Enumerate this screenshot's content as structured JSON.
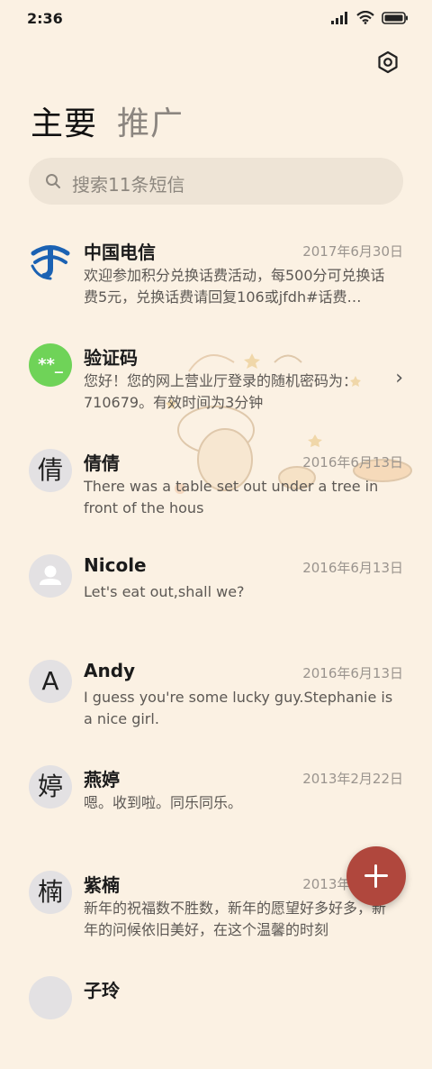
{
  "status": {
    "time": "2:36"
  },
  "tabs": [
    {
      "label": "主要",
      "active": true
    },
    {
      "label": "推广",
      "active": false
    }
  ],
  "search": {
    "placeholder": "搜索11条短信"
  },
  "messages": [
    {
      "name": "中国电信",
      "date": "2017年6月30日",
      "preview": "欢迎参加积分兑换话费活动，每500分可兑换话费5元，兑换话费请回复106或jfdh#话费…",
      "avatar": "",
      "avatar_icon": "china-telecom-logo"
    },
    {
      "name": "验证码",
      "date": "",
      "preview": "您好！您的网上营业厅登录的随机密码为：710679。有效时间为3分钟",
      "avatar": "**_",
      "avatar_color": "#6fd358"
    },
    {
      "name": "倩倩",
      "date": "2016年6月13日",
      "preview": "There was a table set out under a tree in front of the hous",
      "avatar": "倩"
    },
    {
      "name": "Nicole",
      "date": "2016年6月13日",
      "preview": "Let's eat out,shall we?",
      "avatar": "",
      "avatar_icon": "person-icon"
    },
    {
      "name": "Andy",
      "date": "2016年6月13日",
      "preview": "I guess you're some lucky guy.Stephanie is a nice girl.",
      "avatar": "A"
    },
    {
      "name": "燕婷",
      "date": "2013年2月22日",
      "preview": "嗯。收到啦。同乐同乐。",
      "avatar": "婷"
    },
    {
      "name": "紫楠",
      "date": "2013年2月22日",
      "preview": "新年的祝福数不胜数，新年的愿望好多好多，新年的问候依旧美好，在这个温馨的时刻",
      "avatar": "楠"
    },
    {
      "name": "子玲",
      "date": "",
      "preview": "",
      "avatar": ""
    }
  ],
  "colors": {
    "background": "#fbf1e3",
    "fab": "#b0473d",
    "verify_avatar": "#6fd358"
  }
}
